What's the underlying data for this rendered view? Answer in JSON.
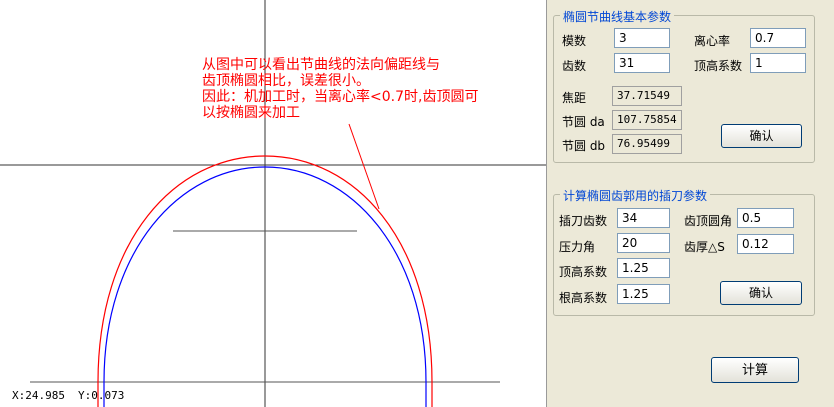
{
  "drawing": {
    "annotation_lines": [
      "从图中可以看出节曲线的法向偏距线与",
      "齿顶椭圆相比，误差很小。",
      "因此：机加工时，当离心率<0.7时,齿顶圆可",
      "以按椭圆来加工"
    ],
    "status_x": "X:24.985",
    "status_y": "Y:0.073",
    "colors": {
      "outer_curve": "#ff0000",
      "inner_curve": "#0000ff",
      "annotation": "#ff0000"
    }
  },
  "ellipse_panel": {
    "title": "椭圆节曲线基本参数",
    "module_label": "模数",
    "module_value": "3",
    "eccentricity_label": "离心率",
    "eccentricity_value": "0.7",
    "teeth_label": "齿数",
    "teeth_value": "31",
    "addendum_label": "顶高系数",
    "addendum_value": "1",
    "focal_label": "焦距",
    "focal_value": "37.71549",
    "pitch_da_label": "节圆 da",
    "pitch_da_value": "107.75854",
    "pitch_db_label": "节圆 db",
    "pitch_db_value": "76.95499",
    "confirm_label": "确认"
  },
  "cutter_panel": {
    "title": "计算椭圆齿郭用的插刀参数",
    "cutter_teeth_label": "插刀齿数",
    "cutter_teeth_value": "34",
    "tip_radius_label": "齿顶圆角",
    "tip_radius_value": "0.5",
    "pressure_angle_label": "压力角",
    "pressure_angle_value": "20",
    "thickness_label": "齿厚△S",
    "thickness_value": "0.12",
    "addendum_label": "顶高系数",
    "addendum_value": "1.25",
    "dedendum_label": "根高系数",
    "dedendum_value": "1.25",
    "confirm_label": "确认"
  },
  "calculate_label": "计算"
}
